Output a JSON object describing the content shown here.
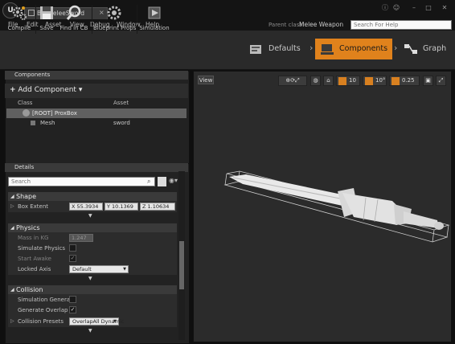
{
  "window": {
    "tab_title": "BP_MeleeSword",
    "menu": [
      "File",
      "Edit",
      "Asset",
      "View",
      "Debug",
      "Window",
      "Help"
    ],
    "parent_class_label": "Parent class:",
    "parent_class_value": "Melee Weapon",
    "help_search_placeholder": "Search For Help"
  },
  "toolbar": {
    "buttons": [
      "Compile",
      "Save",
      "Find in CB",
      "Blueprint Props",
      "Simulation"
    ]
  },
  "modes": {
    "defaults": "Defaults",
    "components": "Components",
    "graph": "Graph"
  },
  "components_panel": {
    "tab": "Components",
    "add_button": "Add Component",
    "col_class": "Class",
    "col_asset": "Asset",
    "root_item": "[ROOT] ProxBox",
    "child_item": "Mesh",
    "child_asset": "sword"
  },
  "details": {
    "tab": "Details",
    "search_placeholder": "Search",
    "shape": {
      "title": "Shape",
      "box_extent_label": "Box Extent",
      "x": "X 55.3934",
      "y": "Y 10.1369",
      "z": "Z 1.10634"
    },
    "physics": {
      "title": "Physics",
      "mass_label": "Mass in KG",
      "mass_value": "1.247",
      "simulate_label": "Simulate Physics",
      "start_awake_label": "Start Awake",
      "locked_axis_label": "Locked Axis",
      "locked_axis_value": "Default"
    },
    "collision": {
      "title": "Collision",
      "sim_gen_hit_label": "Simulation Generat",
      "gen_overlap_label": "Generate Overlap E",
      "presets_label": "Collision Presets",
      "presets_value": "OverlapAll Dynamic"
    }
  },
  "viewport": {
    "view_label": "View",
    "grid_snap": "10",
    "rot_snap": "10°",
    "scale_snap": "0.25"
  }
}
